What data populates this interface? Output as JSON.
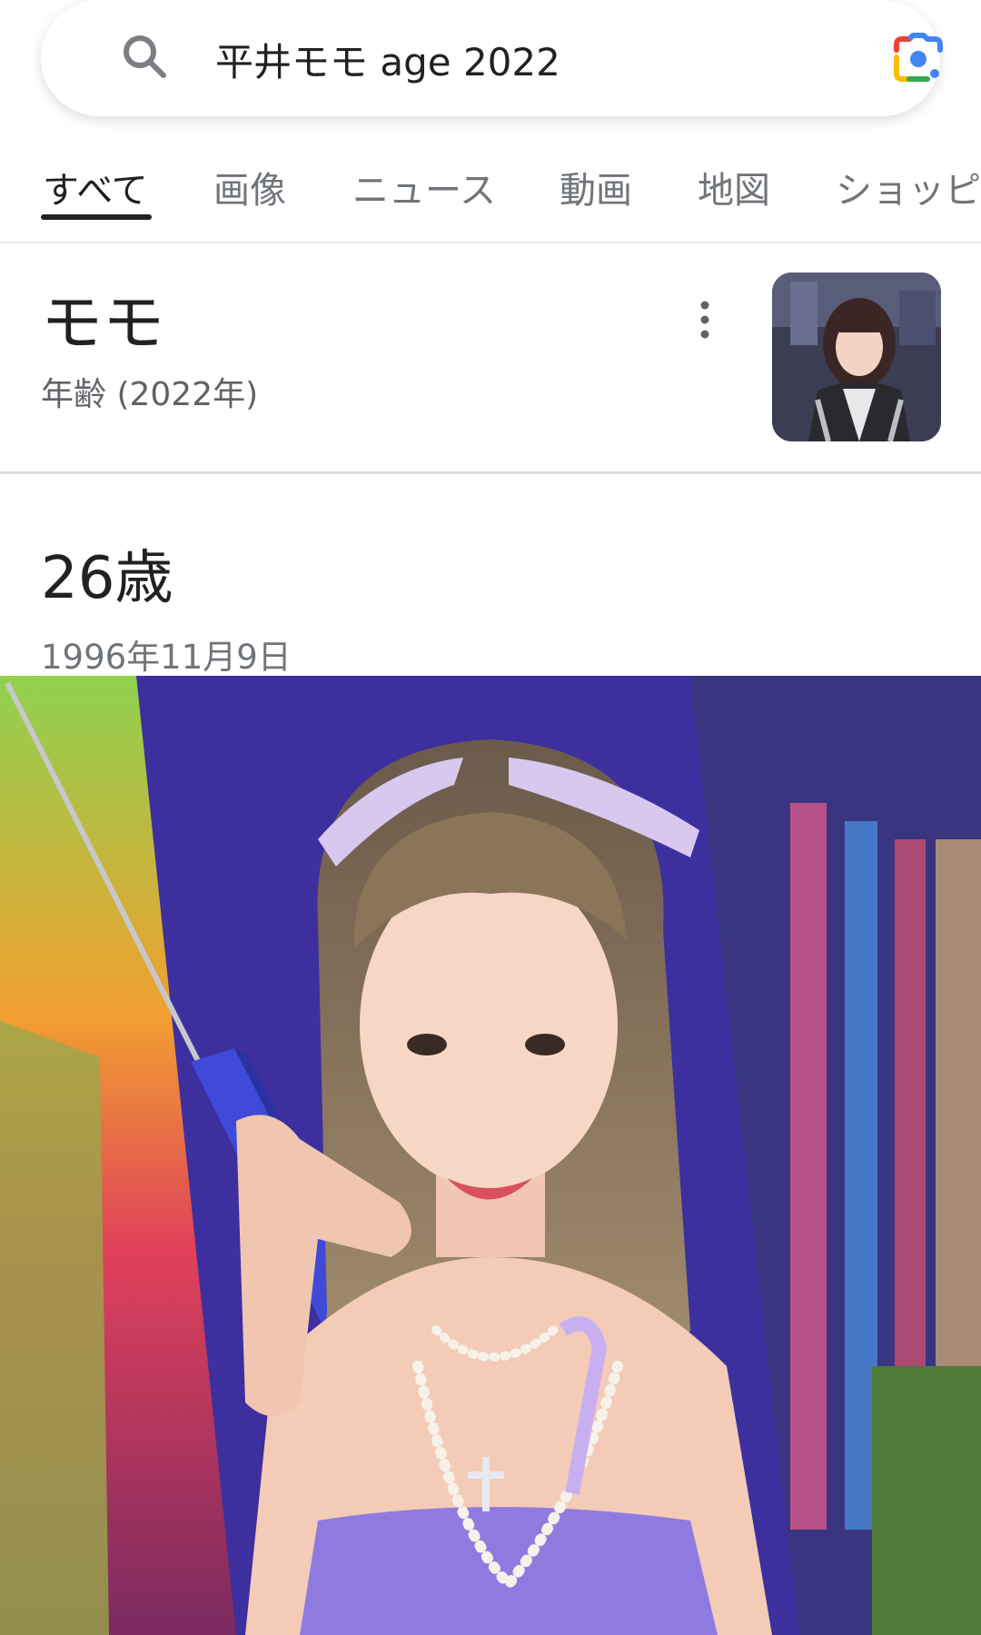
{
  "search": {
    "query": "平井モモ age 2022",
    "search_icon": "search-icon",
    "lens_icon": "google-lens-icon"
  },
  "tabs": [
    {
      "label": "すべて",
      "active": true
    },
    {
      "label": "画像",
      "active": false
    },
    {
      "label": "ニュース",
      "active": false
    },
    {
      "label": "動画",
      "active": false
    },
    {
      "label": "地図",
      "active": false
    },
    {
      "label": "ショッピ",
      "active": false
    }
  ],
  "knowledge": {
    "title": "モモ",
    "subtitle": "年齢 (2022年)",
    "more_icon": "more-vertical-icon",
    "age": "26歳",
    "birth_date": "1996年11月9日"
  },
  "colors": {
    "text_primary": "#202124",
    "text_secondary": "#70757a",
    "divider": "#dadce0",
    "lens_blue": "#4285f4",
    "lens_red": "#ea4335",
    "lens_yellow": "#fbbc05",
    "lens_green": "#34a853"
  }
}
